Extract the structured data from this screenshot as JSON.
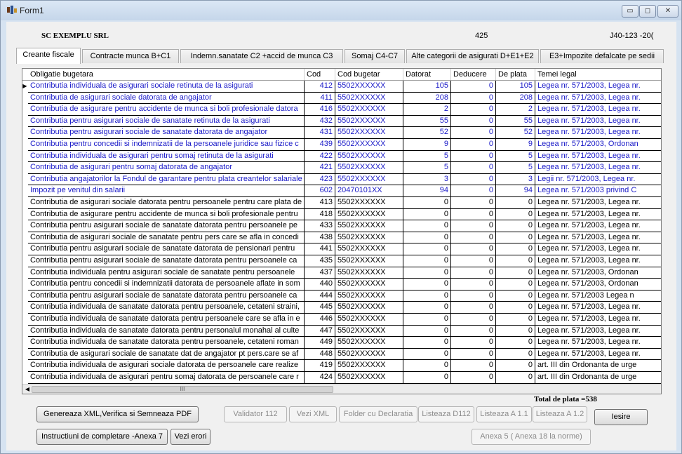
{
  "window": {
    "title": "Form1",
    "controls": {
      "minimize": "▭",
      "maximize": "◻",
      "close": "✕"
    },
    "accent": "#d6e3f1"
  },
  "header": {
    "company": "SC EXEMPLU SRL",
    "number": "425",
    "registration": "J40-123 -20("
  },
  "tabs": [
    {
      "label": "Creante fiscale",
      "active": true
    },
    {
      "label": "Contracte munca B+C1",
      "active": false
    },
    {
      "label": "Indemn.sanatate C2 +accid de munca  C3",
      "active": false
    },
    {
      "label": "Somaj C4-C7",
      "active": false
    },
    {
      "label": "Alte categorii de asigurati D+E1+E2",
      "active": false
    },
    {
      "label": "E3+Impozite defalcate pe sedii",
      "active": false
    }
  ],
  "table": {
    "columns": [
      "Obligatie bugetara",
      "Cod",
      "Cod bugetar",
      "Datorat",
      "Deducere",
      "De plata",
      "Temei legal"
    ],
    "row_colors": {
      "blue": "#1a1ac8",
      "black": "#000000"
    },
    "rows": [
      {
        "blue": true,
        "current": true,
        "cells": [
          "Contributia individuala de asigurari sociale retinuta de la asigurati",
          "412",
          "5502XXXXXX",
          "105",
          "0",
          "105",
          "Legea nr. 571/2003, Legea nr."
        ]
      },
      {
        "blue": true,
        "current": false,
        "cells": [
          "Contributia de asigurari sociale datorata de angajator",
          "411",
          "5502XXXXXX",
          "208",
          "0",
          "208",
          "Legea nr. 571/2003, Legea nr."
        ]
      },
      {
        "blue": true,
        "current": false,
        "cells": [
          "Contributia de asigurare pentru accidente de munca si boli profesionale datora",
          "416",
          "5502XXXXXX",
          "2",
          "0",
          "2",
          "Legea nr. 571/2003, Legea nr."
        ]
      },
      {
        "blue": true,
        "current": false,
        "cells": [
          "Contributia pentru asigurari sociale de sanatate retinuta de la asigurati",
          "432",
          "5502XXXXXX",
          "55",
          "0",
          "55",
          "Legea nr. 571/2003, Legea nr."
        ]
      },
      {
        "blue": true,
        "current": false,
        "cells": [
          "Contributia pentru asigurari sociale de sanatate datorata de angajator",
          "431",
          "5502XXXXXX",
          "52",
          "0",
          "52",
          "Legea nr. 571/2003, Legea nr."
        ]
      },
      {
        "blue": true,
        "current": false,
        "cells": [
          "Contributia pentru concedii si indemnizatii de la persoanele juridice sau fizice c",
          "439",
          "5502XXXXXX",
          "9",
          "0",
          "9",
          "Legea nr. 571/2003, Ordonan"
        ]
      },
      {
        "blue": true,
        "current": false,
        "cells": [
          "Contributia individuala de asigurari pentru somaj retinuta de la asigurati",
          "422",
          "5502XXXXXX",
          "5",
          "0",
          "5",
          "Legea nr. 571/2003, Legea nr."
        ]
      },
      {
        "blue": true,
        "current": false,
        "cells": [
          "Contributia de asigurari pentru somaj datorata de angajator",
          "421",
          "5502XXXXXX",
          "5",
          "0",
          "5",
          "Legea nr. 571/2003, Legea nr."
        ]
      },
      {
        "blue": true,
        "current": false,
        "cells": [
          "Contributia angajatorilor la Fondul de garantare pentru plata creantelor salariale",
          "423",
          "5502XXXXXX",
          "3",
          "0",
          "3",
          "Legii nr. 571/2003, Legea nr."
        ]
      },
      {
        "blue": true,
        "current": false,
        "cells": [
          "Impozit pe venitul din salarii",
          "602",
          "20470101XX",
          "94",
          "0",
          "94",
          "Legea nr. 571/2003 privind C"
        ]
      },
      {
        "blue": false,
        "current": false,
        "cells": [
          "Contributia de asigurari sociale datorata pentru persoanele pentru care plata de",
          "413",
          "5502XXXXXX",
          "0",
          "0",
          "0",
          "Legea nr. 571/2003, Legea nr."
        ]
      },
      {
        "blue": false,
        "current": false,
        "cells": [
          "Contributia de asigurare pentru accidente de munca si boli profesionale pentru",
          "418",
          "5502XXXXXX",
          "0",
          "0",
          "0",
          "Legea nr. 571/2003, Legea nr."
        ]
      },
      {
        "blue": false,
        "current": false,
        "cells": [
          "Contributia pentru asigurari sociale de sanatate datorata pentru persoanele pe",
          "433",
          "5502XXXXXX",
          "0",
          "0",
          "0",
          "Legea nr. 571/2003, Legea nr."
        ]
      },
      {
        "blue": false,
        "current": false,
        "cells": [
          "Contributia de asigurari sociale de sanatate pentru pers care se afla in concedi",
          "438",
          "5502XXXXXX",
          "0",
          "0",
          "0",
          "Legea nr. 571/2003, Legea nr."
        ]
      },
      {
        "blue": false,
        "current": false,
        "cells": [
          "Contributia pentru asigurari sociale de sanatate datorata de pensionari pentru",
          "441",
          "5502XXXXXX",
          "0",
          "0",
          "0",
          "Legea nr. 571/2003, Legea nr."
        ]
      },
      {
        "blue": false,
        "current": false,
        "cells": [
          "Contributia pentru asigurari sociale de sanatate datorata pentru persoanele ca",
          "435",
          "5502XXXXXX",
          "0",
          "0",
          "0",
          "Legea nr. 571/2003, Legea nr."
        ]
      },
      {
        "blue": false,
        "current": false,
        "cells": [
          "Contributia individuala pentru asigurari sociale de sanatate pentru persoanele",
          "437",
          "5502XXXXXX",
          "0",
          "0",
          "0",
          "Legea nr. 571/2003, Ordonan"
        ]
      },
      {
        "blue": false,
        "current": false,
        "cells": [
          "Contributia pentru concedii si indemnizatii datorata de persoanele aflate in som",
          "440",
          "5502XXXXXX",
          "0",
          "0",
          "0",
          "Legea nr. 571/2003, Ordonan"
        ]
      },
      {
        "blue": false,
        "current": false,
        "cells": [
          "Contributia pentru asigurari sociale de sanatate datorata pentru persoanele ca",
          "444",
          "5502XXXXXX",
          "0",
          "0",
          "0",
          "Legea nr. 571/2003 Legea n"
        ]
      },
      {
        "blue": false,
        "current": false,
        "cells": [
          "Contributia individuala de sanatate datorata pentru persoanele, cetateni straini,",
          "445",
          "5502XXXXXX",
          "0",
          "0",
          "0",
          "Legea nr. 571/2003, Legea nr."
        ]
      },
      {
        "blue": false,
        "current": false,
        "cells": [
          "Contributia individuala de sanatate datorata pentru persoanele care se afla in e",
          "446",
          "5502XXXXXX",
          "0",
          "0",
          "0",
          "Legea nr. 571/2003, Legea nr."
        ]
      },
      {
        "blue": false,
        "current": false,
        "cells": [
          "Contributia individuala de sanatate datorata pentru personalul monahal al culte",
          "447",
          "5502XXXXXX",
          "0",
          "0",
          "0",
          "Legea nr. 571/2003, Legea nr."
        ]
      },
      {
        "blue": false,
        "current": false,
        "cells": [
          "Contributia individuala de sanatate datorata pentru persoanele, cetateni roman",
          "449",
          "5502XXXXXX",
          "0",
          "0",
          "0",
          "Legea nr. 571/2003, Legea nr."
        ]
      },
      {
        "blue": false,
        "current": false,
        "cells": [
          "Contributia de asigurari sociale de sanatate dat de angajator pt pers.care se af",
          "448",
          "5502XXXXXX",
          "0",
          "0",
          "0",
          "Legea nr. 571/2003, Legea nr."
        ]
      },
      {
        "blue": false,
        "current": false,
        "cells": [
          "Contributia individuala de asigurari sociale datorata de persoanele care realize",
          "419",
          "5502XXXXXX",
          "0",
          "0",
          "0",
          "art. III din Ordonanta de urge"
        ]
      },
      {
        "blue": false,
        "current": false,
        "cells": [
          "Contributia individuala de asigurari pentru somaj datorata de persoanele care r",
          "424",
          "5502XXXXXX",
          "0",
          "0",
          "0",
          "art. III din Ordonanta de urge"
        ]
      }
    ],
    "scroll_thumb_glyph": "III"
  },
  "total": "Total de plata =538",
  "buttons": {
    "generate": "Genereaza XML,Verifica si Semneaza PDF",
    "validator": "Validator 112",
    "vezi_xml": "Vezi XML",
    "folder": "Folder cu Declaratia",
    "listeaza_d112": "Listeaza D112",
    "listeaza_a11": "Listeaza A 1.1",
    "listeaza_a12": "Listeaza A 1.2",
    "iesire": "Iesire",
    "instructiuni": "Instructiuni de completare -Anexa 7",
    "vezi_erori": "Vezi erori",
    "anexa5": "Anexa  5 ( Anexa 18 la norme)"
  }
}
